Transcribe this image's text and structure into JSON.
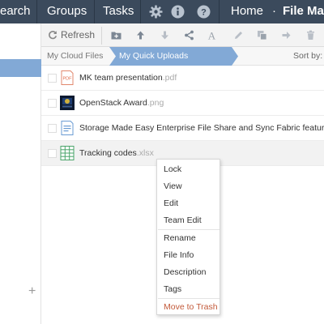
{
  "nav": {
    "search_label": "earch",
    "groups_label": "Groups",
    "tasks_label": "Tasks",
    "home_label": "Home",
    "separator": "·",
    "file_manager_label": "File Ma"
  },
  "toolbar": {
    "refresh_label": "Refresh"
  },
  "breadcrumb": {
    "cloud_files": "My Cloud Files",
    "quick_uploads": "My Quick Uploads",
    "sort_by": "Sort by:"
  },
  "files": [
    {
      "name": "MK team presentation",
      "ext": ".pdf",
      "type": "pdf",
      "icon_text": "PDF"
    },
    {
      "name": "OpenStack Award",
      "ext": ".png",
      "type": "image"
    },
    {
      "name": "Storage Made Easy Enterprise File Share and Sync Fabric featur...",
      "ext": "",
      "type": "doc"
    },
    {
      "name": "Tracking codes",
      "ext": ".xlsx",
      "type": "spreadsheet"
    }
  ],
  "context_menu": {
    "items": [
      "Lock",
      "View",
      "Edit",
      "Team Edit",
      "Rename",
      "File Info",
      "Description",
      "Tags",
      "Move to Trash"
    ]
  },
  "colors": {
    "nav_bg": "#3b4a5c",
    "accent": "#82a9d6",
    "danger": "#c35a3a"
  }
}
